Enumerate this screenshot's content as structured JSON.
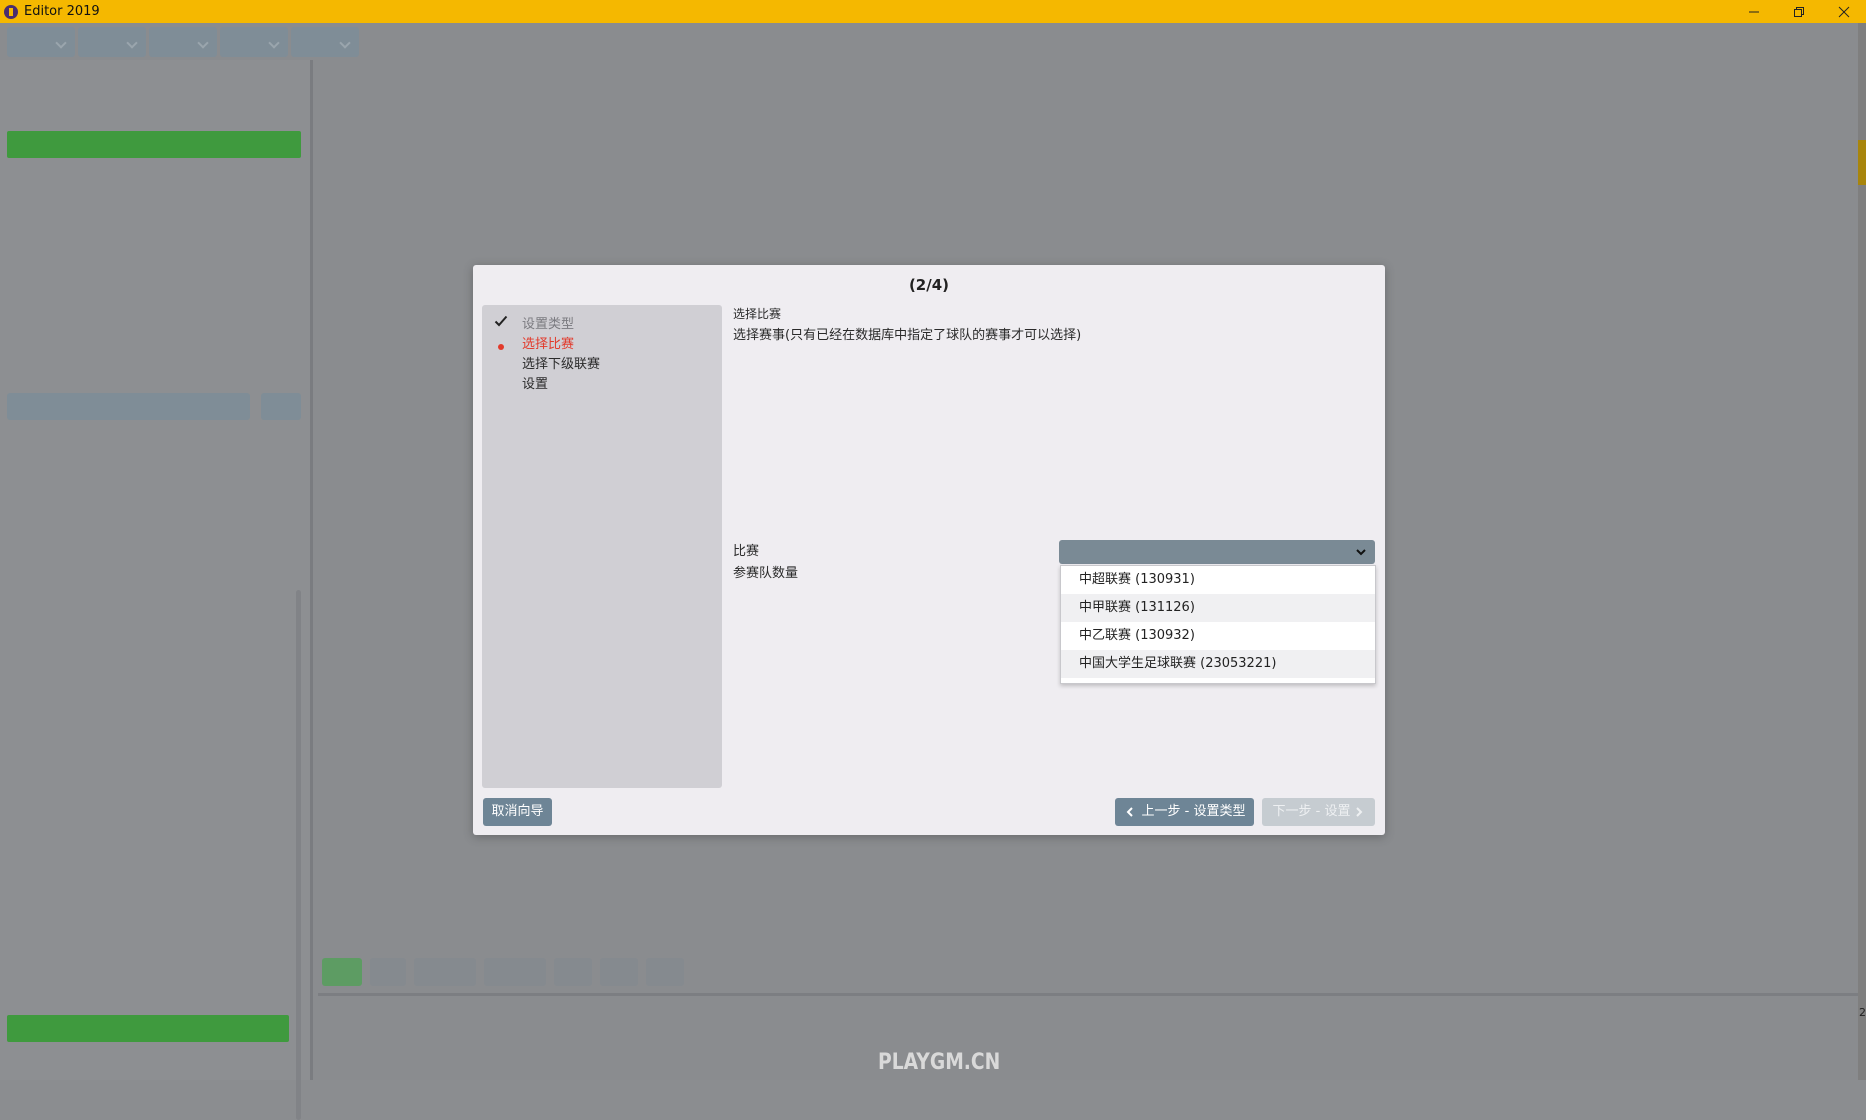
{
  "window": {
    "title": "Editor 2019"
  },
  "dialog": {
    "step_counter": "(2/4)",
    "steps": [
      {
        "label": "设置类型",
        "state": "done"
      },
      {
        "label": "选择比赛",
        "state": "current"
      },
      {
        "label": "选择下级联赛",
        "state": "pending"
      },
      {
        "label": "设置",
        "state": "pending"
      }
    ],
    "content_title": "选择比赛",
    "content_desc": "选择赛事(只有已经在数据库中指定了球队的赛事才可以选择)",
    "fields": {
      "competition_label": "比赛",
      "team_count_label": "参赛队数量"
    },
    "dropdown_options": [
      "中超联赛 (130931)",
      "中甲联赛 (131126)",
      "中乙联赛 (130932)",
      "中国大学生足球联赛 (23053221)"
    ],
    "buttons": {
      "cancel": "取消向导",
      "prev": "上一步 - 设置类型",
      "next": "下一步 - 设置"
    }
  },
  "watermark": "PLAYGM.CN",
  "edge_number": "2",
  "colors": {
    "titlebar": "#f5b800",
    "accent_green": "#3f9a3e",
    "current_step": "#e23a2b",
    "button": "#6e8596"
  }
}
